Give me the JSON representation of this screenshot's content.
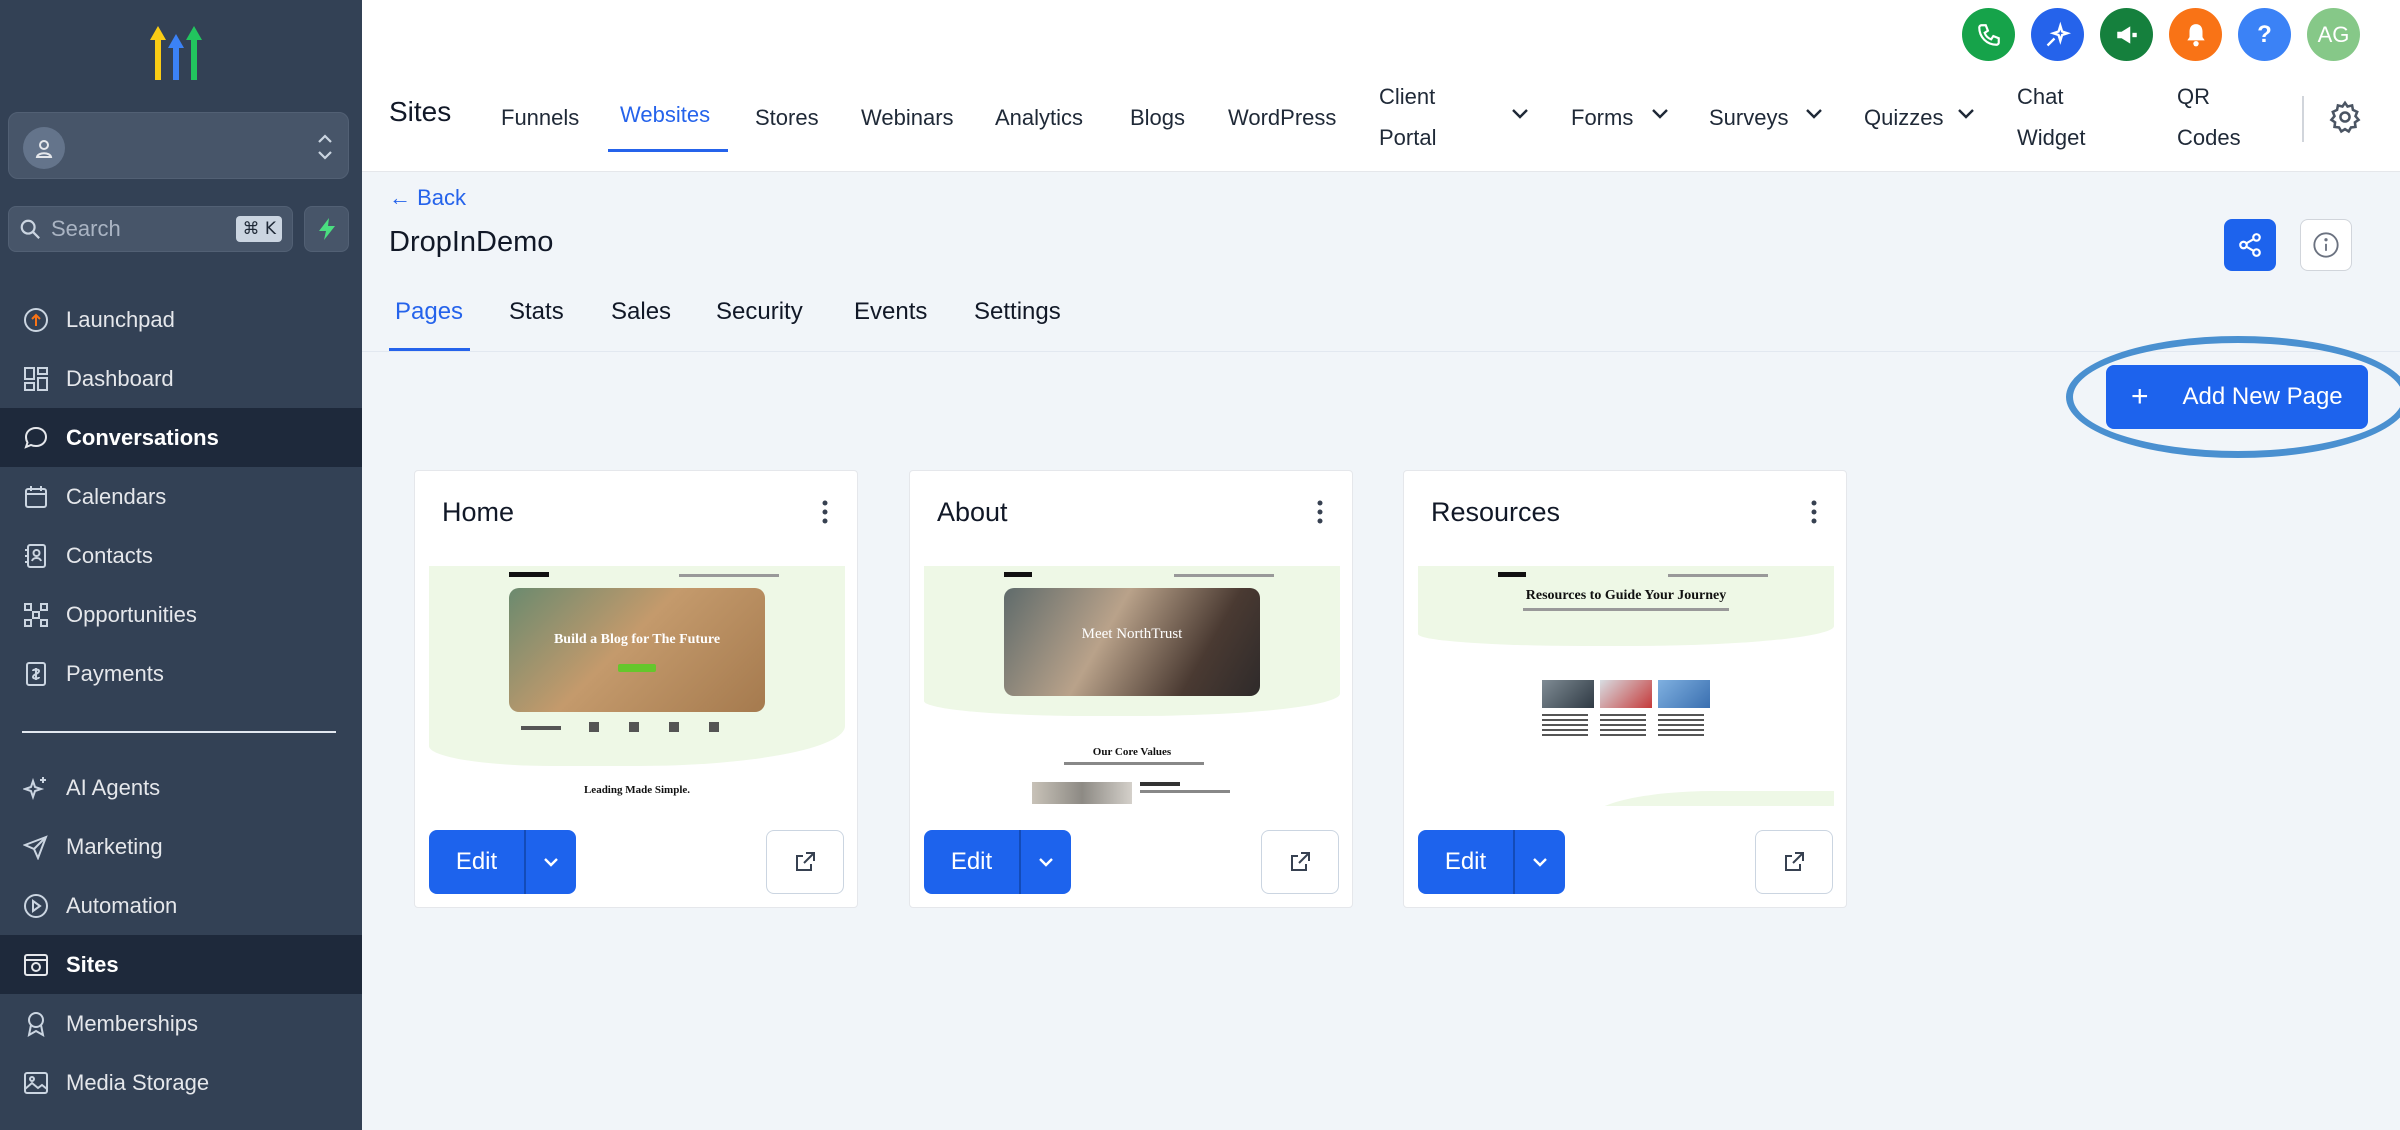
{
  "colors": {
    "primary": "#1d63ed",
    "sidebar_bg": "#334155",
    "sidebar_active": "#1e293b",
    "ring": "#4a90d0"
  },
  "sidebar": {
    "search": {
      "placeholder": "Search",
      "shortcut": "⌘ K"
    },
    "items_top": [
      {
        "label": "Launchpad",
        "icon": "rocket-icon"
      },
      {
        "label": "Dashboard",
        "icon": "grid-icon"
      },
      {
        "label": "Conversations",
        "icon": "chat-icon",
        "active": true
      },
      {
        "label": "Calendars",
        "icon": "calendar-icon"
      },
      {
        "label": "Contacts",
        "icon": "contacts-icon"
      },
      {
        "label": "Opportunities",
        "icon": "opportunities-icon"
      },
      {
        "label": "Payments",
        "icon": "payments-icon"
      }
    ],
    "items_bottom": [
      {
        "label": "AI Agents",
        "icon": "sparkle-icon"
      },
      {
        "label": "Marketing",
        "icon": "send-icon"
      },
      {
        "label": "Automation",
        "icon": "automation-icon"
      },
      {
        "label": "Sites",
        "icon": "sites-icon",
        "active": true
      },
      {
        "label": "Memberships",
        "icon": "badge-icon"
      },
      {
        "label": "Media Storage",
        "icon": "image-icon"
      }
    ]
  },
  "header": {
    "title": "Sites",
    "avatar_initials": "AG",
    "help_glyph": "?",
    "tabs": {
      "funnels": "Funnels",
      "websites": "Websites",
      "stores": "Stores",
      "webinars": "Webinars",
      "analytics": "Analytics",
      "blogs": "Blogs",
      "wordpress": "WordPress",
      "client_portal_1": "Client",
      "client_portal_2": "Portal",
      "forms": "Forms",
      "surveys": "Surveys",
      "quizzes": "Quizzes",
      "chat_widget_1": "Chat",
      "chat_widget_2": "Widget",
      "qr_codes_1": "QR",
      "qr_codes_2": "Codes"
    }
  },
  "main": {
    "back_label": "← Back",
    "page_title": "DropInDemo",
    "subtabs": [
      "Pages",
      "Stats",
      "Sales",
      "Security",
      "Events",
      "Settings"
    ],
    "add_button": "Add New Page",
    "add_plus": "+",
    "cards": [
      {
        "title": "Home",
        "edit_label": "Edit",
        "thumb": {
          "hero_title": "Build a Blog for The Future",
          "accent_word": "Blog",
          "hero_button": "Get Started",
          "footer_text": "Leading Made Simple."
        }
      },
      {
        "title": "About",
        "edit_label": "Edit",
        "thumb": {
          "hero_title": "Meet NorthTrust",
          "accent_word": "NorthTrust",
          "section_title": "Our Core Values"
        }
      },
      {
        "title": "Resources",
        "edit_label": "Edit",
        "thumb": {
          "hero_title": "Resources to Guide Your Journey",
          "accent_word": "Guide"
        }
      }
    ]
  }
}
